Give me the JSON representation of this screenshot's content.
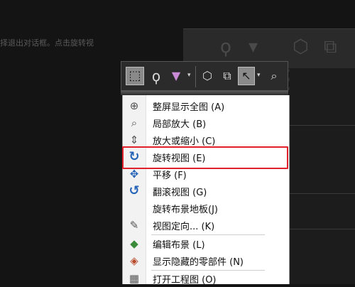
{
  "background": {
    "text": "择退出对话框。点击旋转视"
  },
  "toolbar": {
    "buttons": [
      {
        "name": "box-select",
        "glyph": "⬚"
      },
      {
        "name": "lasso",
        "glyph": "ϙ"
      },
      {
        "name": "filter",
        "glyph": "▼"
      },
      {
        "name": "view-orient",
        "glyph": "⬡"
      },
      {
        "name": "view-cube",
        "glyph": "⧉"
      },
      {
        "name": "select-arrow",
        "glyph": "↖"
      },
      {
        "name": "magnify",
        "glyph": "⌕"
      }
    ]
  },
  "menu": {
    "items": [
      {
        "label": "整屏显示全图 (A)",
        "icon": "zoom-fit-icon",
        "glyph": "⊕"
      },
      {
        "label": "局部放大 (B)",
        "icon": "zoom-area-icon",
        "glyph": "⌕"
      },
      {
        "label": "放大或缩小 (C)",
        "icon": "zoom-in-out-icon",
        "glyph": "⇕"
      },
      {
        "label": "旋转视图 (E)",
        "icon": "rotate-view-icon",
        "glyph": "↻"
      },
      {
        "label": "平移 (F)",
        "icon": "pan-icon",
        "glyph": "✥"
      },
      {
        "label": "翻滚视图 (G)",
        "icon": "roll-view-icon",
        "glyph": "↺"
      },
      {
        "label": "旋转布景地板(J)",
        "icon": "",
        "glyph": ""
      },
      {
        "label": "视图定向... (K)",
        "icon": "view-orientation-icon",
        "glyph": "✎"
      },
      {
        "label": "编辑布景 (L)",
        "icon": "edit-scene-icon",
        "glyph": "◆"
      },
      {
        "label": "显示隐藏的零部件 (N)",
        "icon": "show-hidden-components-icon",
        "glyph": "◈"
      },
      {
        "label": "打开工程图 (O)",
        "icon": "open-drawing-icon",
        "glyph": "▦"
      }
    ]
  },
  "colors": {
    "highlight": "#e0202a",
    "icon_blue": "#2563b8"
  }
}
